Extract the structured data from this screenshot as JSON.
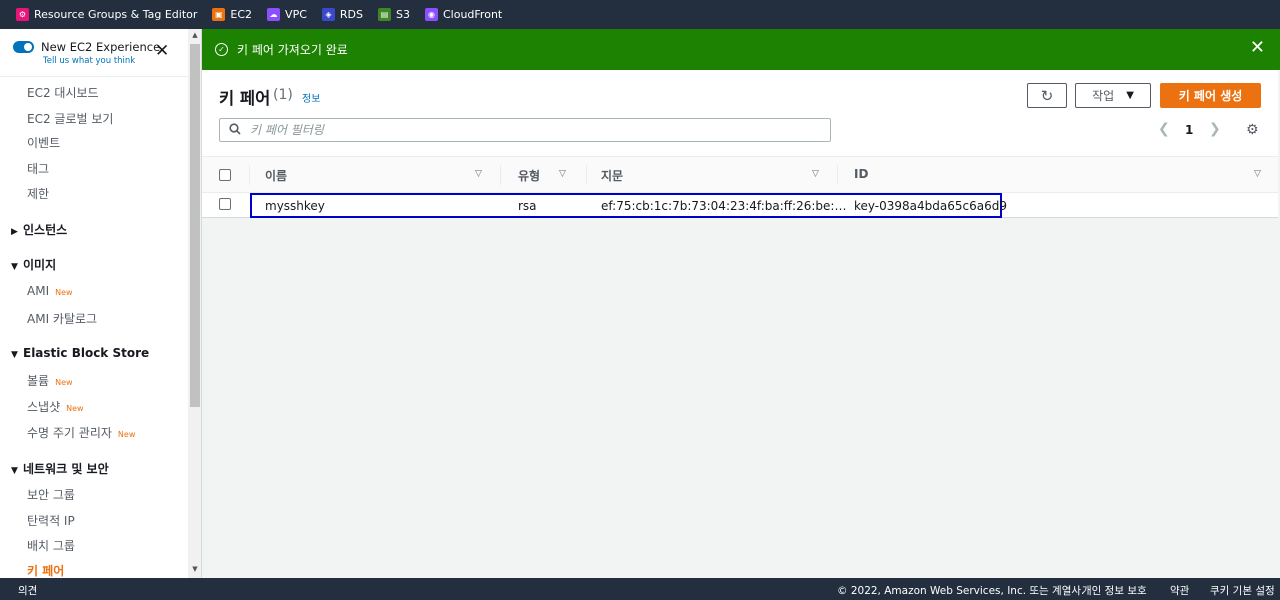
{
  "topbar": {
    "favorites": [
      {
        "label": "Resource Groups & Tag Editor",
        "color": "#e7157b",
        "icon": "resource-groups-icon"
      },
      {
        "label": "EC2",
        "color": "#ec7211",
        "icon": "ec2-icon"
      },
      {
        "label": "VPC",
        "color": "#8c4fff",
        "icon": "vpc-icon"
      },
      {
        "label": "RDS",
        "color": "#3b48cc",
        "icon": "rds-icon"
      },
      {
        "label": "S3",
        "color": "#3f8624",
        "icon": "s3-icon"
      },
      {
        "label": "CloudFront",
        "color": "#8c4fff",
        "icon": "cloudfront-icon"
      }
    ]
  },
  "sidebar": {
    "experience_title": "New EC2 Experience",
    "experience_sub": "Tell us what you think",
    "new_badge": "New",
    "items": [
      {
        "label": "EC2 대시보드"
      },
      {
        "label": "EC2 글로벌 보기"
      },
      {
        "label": "이벤트"
      },
      {
        "label": "태그"
      },
      {
        "label": "제한"
      }
    ],
    "sections": {
      "instances": "인스턴스",
      "images": "이미지",
      "ebs": "Elastic Block Store",
      "network": "네트워크 및 보안"
    },
    "images_items": [
      "AMI",
      "AMI 카탈로그"
    ],
    "ebs_items": [
      "볼륨",
      "스냅샷",
      "수명 주기 관리자"
    ],
    "network_items": [
      "보안 그룹",
      "탄력적 IP",
      "배치 그룹",
      "키 페어"
    ]
  },
  "flash": {
    "message": "키 페어 가져오기 완료"
  },
  "main": {
    "title": "키 페어",
    "count": "(1)",
    "info": "정보",
    "actions_label": "작업",
    "create_label": "키 페어 생성",
    "search_placeholder": "키 페어 필터링",
    "page": "1",
    "columns": [
      "이름",
      "유형",
      "지문",
      "ID"
    ],
    "rows": [
      {
        "name": "mysshkey",
        "type": "rsa",
        "fingerprint": "ef:75:cb:1c:7b:73:04:23:4f:ba:ff:26:be:…",
        "id": "key-0398a4bda65c6a6d9"
      }
    ]
  },
  "footer": {
    "feedback": "의견",
    "copyright": "© 2022, Amazon Web Services, Inc. 또는 계열사.",
    "privacy": "개인 정보 보호",
    "terms": "약관",
    "cookies": "쿠키 기본 설정"
  }
}
